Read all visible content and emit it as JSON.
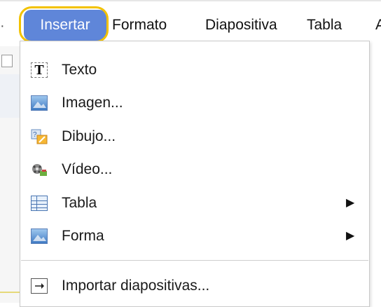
{
  "menubar": {
    "items": [
      {
        "label": "Insertar"
      },
      {
        "label": "Formato"
      },
      {
        "label": "Diapositiva"
      },
      {
        "label": "Tabla"
      },
      {
        "label": "A"
      }
    ]
  },
  "menu": {
    "items": [
      {
        "label": "Texto",
        "icon": "text-box-icon"
      },
      {
        "label": "Imagen...",
        "icon": "image-icon"
      },
      {
        "label": "Dibujo...",
        "icon": "drawing-icon"
      },
      {
        "label": "Vídeo...",
        "icon": "video-icon"
      },
      {
        "label": "Tabla",
        "icon": "table-icon",
        "submenu": "▶"
      },
      {
        "label": "Forma",
        "icon": "shape-icon",
        "submenu": "▶"
      },
      {
        "label": "Importar diapositivas...",
        "icon": "import-icon"
      }
    ]
  },
  "colors": {
    "active_menu_bg": "#5f86d9",
    "highlight_ring": "#f2c200"
  }
}
